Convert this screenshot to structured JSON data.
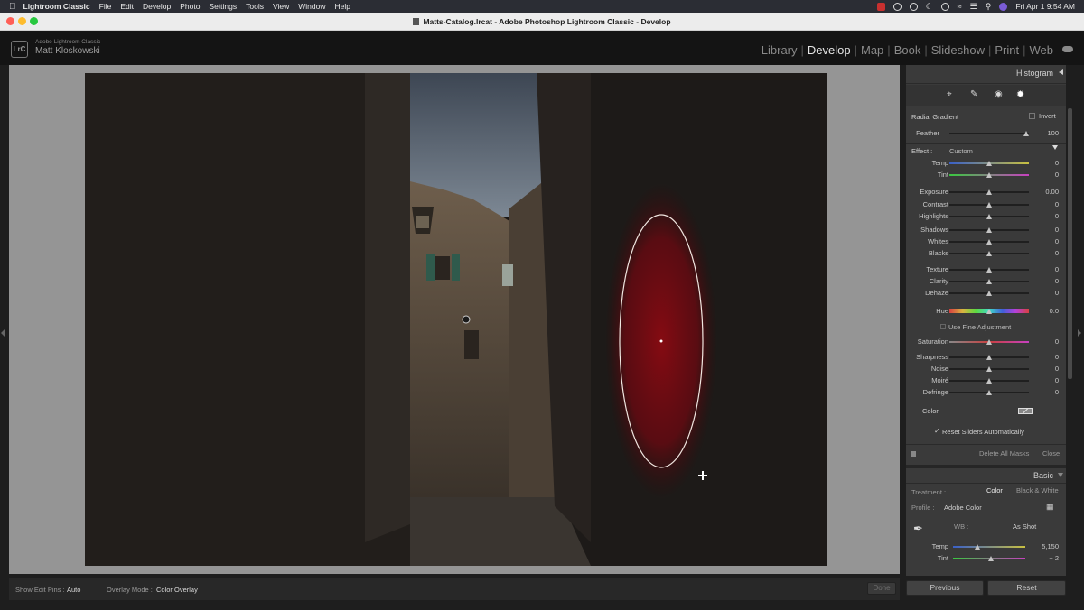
{
  "menubar": {
    "app": "Lightroom Classic",
    "items": [
      "File",
      "Edit",
      "Develop",
      "Photo",
      "Settings",
      "Tools",
      "View",
      "Window",
      "Help"
    ],
    "clock": "Fri Apr 1  9:54 AM"
  },
  "window": {
    "title": "Matts-Catalog.lrcat - Adobe Photoshop Lightroom Classic - Develop"
  },
  "identity": {
    "badge": "LrC",
    "app_name": "Adobe Lightroom Classic",
    "user": "Matt Kloskowski"
  },
  "modules": [
    "Library",
    "Develop",
    "Map",
    "Book",
    "Slideshow",
    "Print",
    "Web"
  ],
  "active_module": "Develop",
  "toolbar": {
    "show_pins_label": "Show Edit Pins :",
    "show_pins_value": "Auto",
    "overlay_label": "Overlay Mode :",
    "overlay_value": "Color Overlay",
    "done": "Done"
  },
  "panel": {
    "histogram": "Histogram",
    "mask": {
      "title": "Radial Gradient",
      "invert": "Invert",
      "feather_label": "Feather",
      "feather_value": "100",
      "effect_label": "Effect :",
      "effect_value": "Custom",
      "hue_label": "Hue",
      "hue_value": "0.0",
      "fine_adjust": "Use Fine Adjustment",
      "color_label": "Color",
      "reset_sliders": "Reset Sliders Automatically",
      "delete_all": "Delete All Masks",
      "close": "Close"
    },
    "sliders": [
      {
        "label": "Temp",
        "value": "0",
        "level": 0.5
      },
      {
        "label": "Tint",
        "value": "0",
        "level": 0.5
      },
      {
        "label": "Exposure",
        "value": "0.00",
        "level": 0.5
      },
      {
        "label": "Contrast",
        "value": "0",
        "level": 0.5
      },
      {
        "label": "Highlights",
        "value": "0",
        "level": 0.5
      },
      {
        "label": "Shadows",
        "value": "0",
        "level": 0.5
      },
      {
        "label": "Whites",
        "value": "0",
        "level": 0.5
      },
      {
        "label": "Blacks",
        "value": "0",
        "level": 0.5
      },
      {
        "label": "Texture",
        "value": "0",
        "level": 0.5
      },
      {
        "label": "Clarity",
        "value": "0",
        "level": 0.5
      },
      {
        "label": "Dehaze",
        "value": "0",
        "level": 0.5
      },
      {
        "label": "Saturation",
        "value": "0",
        "level": 0.5
      },
      {
        "label": "Sharpness",
        "value": "0",
        "level": 0.5
      },
      {
        "label": "Noise",
        "value": "0",
        "level": 0.5
      },
      {
        "label": "Moiré",
        "value": "0",
        "level": 0.5
      },
      {
        "label": "Defringe",
        "value": "0",
        "level": 0.5
      }
    ],
    "basic": {
      "title": "Basic",
      "treatment_label": "Treatment :",
      "color_opt": "Color",
      "bw_opt": "Black & White",
      "profile_label": "Profile :",
      "profile_value": "Adobe Color",
      "wb_label": "WB :",
      "wb_value": "As Shot",
      "temp_label": "Temp",
      "temp_value": "5,150",
      "tint_label": "Tint",
      "tint_value": "+ 2"
    },
    "previous": "Previous",
    "reset": "Reset"
  },
  "colors": {
    "accent_overlay": "#8b0a12",
    "panel_bg": "#3a3a3a",
    "canvas_bg": "#959595"
  }
}
